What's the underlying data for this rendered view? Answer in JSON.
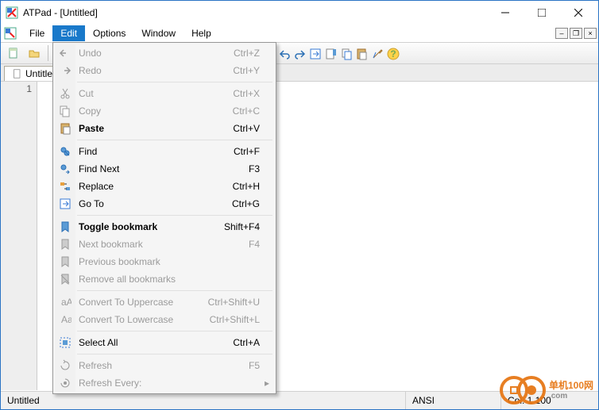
{
  "window": {
    "title": "ATPad - [Untitled]"
  },
  "menubar": {
    "file": "File",
    "edit": "Edit",
    "options": "Options",
    "window": "Window",
    "help": "Help"
  },
  "tabs": {
    "untitled": "Untitled"
  },
  "gutter": {
    "line1": "1"
  },
  "statusbar": {
    "doc": "Untitled",
    "encoding": "ANSI",
    "pos": "Col: 1   100"
  },
  "edit_menu": {
    "items": [
      {
        "label": "Undo",
        "shortcut": "Ctrl+Z",
        "icon": "undo",
        "disabled": true
      },
      {
        "label": "Redo",
        "shortcut": "Ctrl+Y",
        "icon": "redo",
        "disabled": true
      },
      {
        "sep": true
      },
      {
        "label": "Cut",
        "shortcut": "Ctrl+X",
        "icon": "cut",
        "disabled": true
      },
      {
        "label": "Copy",
        "shortcut": "Ctrl+C",
        "icon": "copy",
        "disabled": true
      },
      {
        "label": "Paste",
        "shortcut": "Ctrl+V",
        "icon": "paste",
        "bold": true
      },
      {
        "sep": true
      },
      {
        "label": "Find",
        "shortcut": "Ctrl+F",
        "icon": "find"
      },
      {
        "label": "Find Next",
        "shortcut": "F3",
        "icon": "findnext"
      },
      {
        "label": "Replace",
        "shortcut": "Ctrl+H",
        "icon": "replace"
      },
      {
        "label": "Go To",
        "shortcut": "Ctrl+G",
        "icon": "goto"
      },
      {
        "sep": true
      },
      {
        "label": "Toggle bookmark",
        "shortcut": "Shift+F4",
        "icon": "bookmark",
        "bold": true
      },
      {
        "label": "Next bookmark",
        "shortcut": "F4",
        "icon": "bookmark-next",
        "disabled": true
      },
      {
        "label": "Previous bookmark",
        "shortcut": "",
        "icon": "bookmark-prev",
        "disabled": true
      },
      {
        "label": "Remove all bookmarks",
        "shortcut": "",
        "icon": "bookmark-remove",
        "disabled": true
      },
      {
        "sep": true
      },
      {
        "label": "Convert To Uppercase",
        "shortcut": "Ctrl+Shift+U",
        "icon": "uppercase",
        "disabled": true
      },
      {
        "label": "Convert To Lowercase",
        "shortcut": "Ctrl+Shift+L",
        "icon": "lowercase",
        "disabled": true
      },
      {
        "sep": true
      },
      {
        "label": "Select All",
        "shortcut": "Ctrl+A",
        "icon": "select-all"
      },
      {
        "sep": true
      },
      {
        "label": "Refresh",
        "shortcut": "F5",
        "icon": "refresh",
        "disabled": true
      },
      {
        "label": "Refresh Every:",
        "shortcut": "",
        "icon": "refresh-every",
        "disabled": true,
        "submenu": true
      }
    ]
  },
  "watermark": {
    "text1": "单机100网",
    "text2": ".com"
  }
}
